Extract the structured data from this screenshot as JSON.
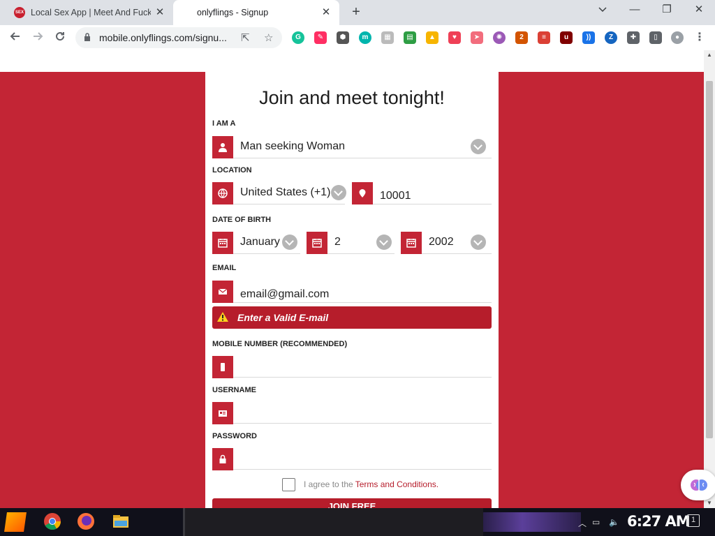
{
  "browser": {
    "tabs": [
      {
        "title": "Local Sex App | Meet And Fuck",
        "favicon": "SEX"
      },
      {
        "title": "onlyflings - Signup"
      }
    ],
    "url": "mobile.onlyflings.com/signu...",
    "new_tab": "+",
    "window_controls": {
      "minimize": "—",
      "restore": "❐",
      "close": "✕",
      "tabsearch": "⌄"
    }
  },
  "form": {
    "headline": "Join and meet tonight!",
    "i_am_a": {
      "label": "I AM A",
      "value": "Man seeking Woman"
    },
    "location": {
      "label": "LOCATION",
      "country": "United States (+1)",
      "zip": "10001"
    },
    "dob": {
      "label": "DATE OF BIRTH",
      "month": "January",
      "day": "2",
      "year": "2002"
    },
    "email": {
      "label": "EMAIL",
      "value": "email@gmail.com",
      "error": "Enter a Valid E-mail"
    },
    "mobile": {
      "label": "MOBILE NUMBER (RECOMMENDED)",
      "value": ""
    },
    "username": {
      "label": "USERNAME",
      "value": ""
    },
    "password": {
      "label": "PASSWORD",
      "value": ""
    },
    "terms": {
      "text": "I agree to the",
      "link": "Terms and Conditions."
    },
    "submit": "JOIN FREE"
  },
  "taskbar": {
    "clock": "6:27 AM",
    "notifications": "1"
  },
  "colors": {
    "brand_red": "#c32535",
    "error_red": "#b61d2b"
  }
}
